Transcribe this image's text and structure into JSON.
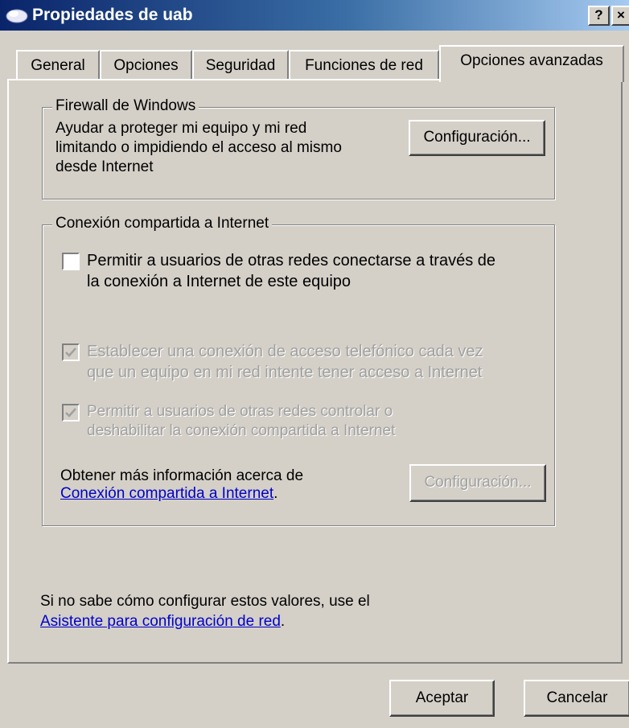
{
  "window": {
    "title": "Propiedades de uab",
    "help_button": "?",
    "close_button": "×"
  },
  "tabs": [
    {
      "label": "General"
    },
    {
      "label": "Opciones"
    },
    {
      "label": "Seguridad"
    },
    {
      "label": "Funciones de red"
    },
    {
      "label": "Opciones avanzadas",
      "active": true
    }
  ],
  "firewall": {
    "legend": "Firewall de Windows",
    "description_lines": [
      "Ayudar a proteger mi equipo y mi red",
      "limitando o impidiendo el acceso al mismo",
      "desde Internet"
    ],
    "config_button": "Configuración..."
  },
  "ics": {
    "legend": "Conexión compartida a Internet",
    "allow_sharing": {
      "checked": false,
      "lines": [
        "Permitir a usuarios de otras redes conectarse a través de",
        "la conexión a Internet de este equipo"
      ]
    },
    "dial_on_demand": {
      "checked": true,
      "disabled": true,
      "lines": [
        "Establecer una conexión de acceso telefónico cada vez",
        "que un equipo en mi red intente tener acceso a Internet"
      ]
    },
    "allow_control": {
      "checked": true,
      "disabled": true,
      "lines": [
        "Permitir a usuarios de otras redes controlar o",
        "deshabilitar la conexión compartida a Internet"
      ]
    },
    "more_info_text": "Obtener más información acerca de",
    "more_info_link": "Conexión compartida a Internet",
    "more_info_period": ".",
    "config_button": "Configuración..."
  },
  "footer": {
    "help_text": "Si no sabe cómo configurar estos valores, use el",
    "wizard_link": "Asistente para configuración de red",
    "wizard_period": "."
  },
  "buttons": {
    "accept": "Aceptar",
    "cancel": "Cancelar"
  }
}
